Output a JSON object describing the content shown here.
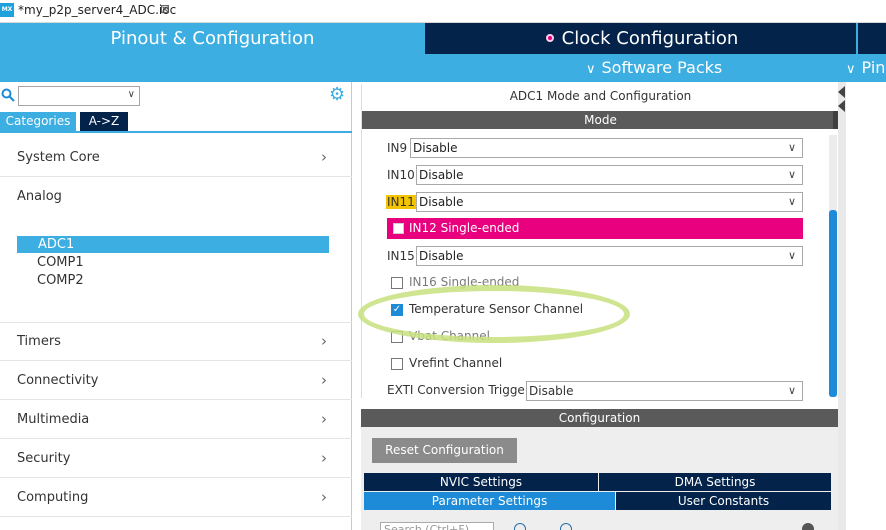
{
  "editor_tab": {
    "logo": "MX",
    "title": "*my_p2p_server4_ADC.ioc",
    "close": "⊠"
  },
  "nav": {
    "pinout": "Pinout & Configuration",
    "clock": "Clock Configuration",
    "software_packs": "Software Packs",
    "pinout_view_partial": "Pin"
  },
  "left_panel": {
    "search_placeholder": "",
    "tabs": {
      "categories": "Categories",
      "az": "A->Z"
    },
    "categories": [
      {
        "label": "System Core",
        "arrow": "›"
      },
      {
        "label": "Analog"
      },
      {
        "label": "Timers",
        "arrow": "›"
      },
      {
        "label": "Connectivity",
        "arrow": "›"
      },
      {
        "label": "Multimedia",
        "arrow": "›"
      },
      {
        "label": "Security",
        "arrow": "›"
      },
      {
        "label": "Computing",
        "arrow": "›"
      }
    ],
    "analog_items": [
      "ADC1",
      "COMP1",
      "COMP2"
    ]
  },
  "mode": {
    "title": "ADC1 Mode and Configuration",
    "bar": "Mode",
    "inputs": [
      {
        "label": "IN9",
        "value": "Disable"
      },
      {
        "label": "IN10",
        "value": "Disable"
      },
      {
        "label": "IN11",
        "value": "Disable"
      },
      {
        "label": "IN15",
        "value": "Disable"
      }
    ],
    "in12": "IN12 Single-ended",
    "checkboxes": [
      {
        "label": "IN16 Single-ended",
        "checked": false
      },
      {
        "label": "Temperature Sensor Channel",
        "checked": true
      },
      {
        "label": "Vbat Channel",
        "checked": false
      },
      {
        "label": "Vrefint Channel",
        "checked": false
      }
    ],
    "exti_label": "EXTI Conversion Trigger",
    "exti_value": "Disable"
  },
  "config": {
    "bar": "Configuration",
    "reset": "Reset Configuration",
    "tabs": [
      "NVIC Settings",
      "DMA Settings",
      "Parameter Settings",
      "User Constants"
    ],
    "search_placeholder": "Search (Ctrl+F)"
  },
  "colors": {
    "accent_blue": "#3caee2",
    "navy": "#03234b",
    "pink": "#e8007e",
    "highlight_yellow": "#f5c400",
    "annotation_green": "#c8e07e"
  }
}
